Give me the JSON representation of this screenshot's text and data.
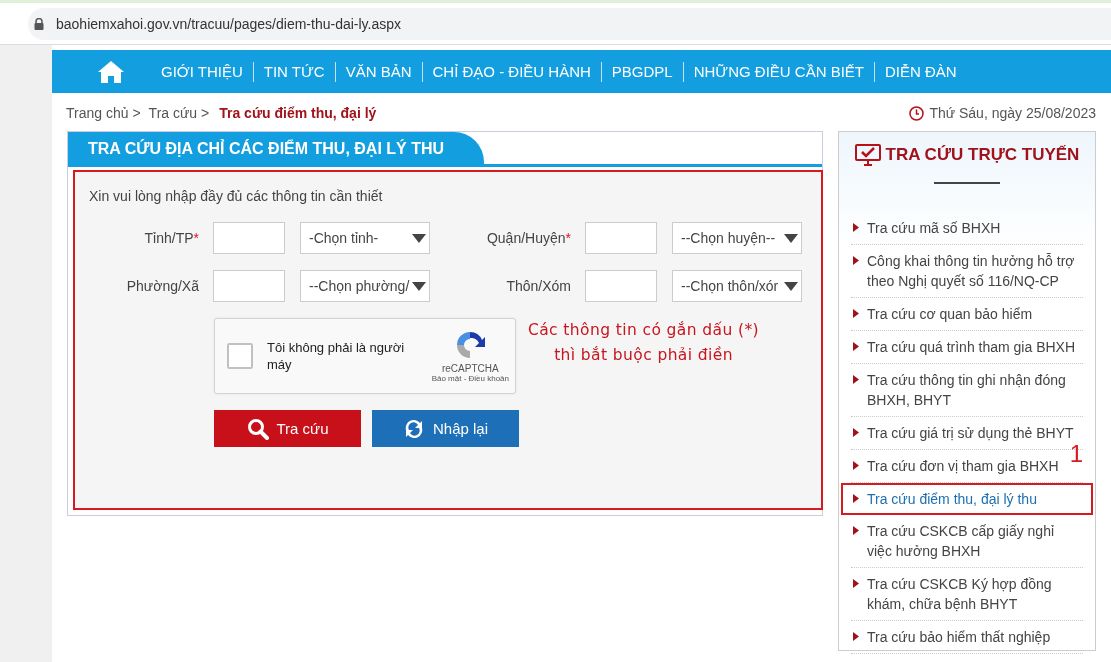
{
  "address_bar": {
    "url": "baohiemxahoi.gov.vn/tracuu/pages/diem-thu-dai-ly.aspx"
  },
  "nav": {
    "items": [
      "GIỚI THIỆU",
      "TIN TỨC",
      "VĂN BẢN",
      "CHỈ ĐẠO - ĐIỀU HÀNH",
      "PBGDPL",
      "NHỮNG ĐIỀU CẦN BIẾT",
      "DIỄN ĐÀN"
    ]
  },
  "breadcrumb": {
    "items": [
      "Trang chủ >",
      "Tra cứu >"
    ],
    "current": "Tra cứu điểm thu, đại lý",
    "date": "Thứ Sáu, ngày 25/08/2023"
  },
  "form": {
    "title": "TRA CỨU ĐỊA CHỈ CÁC ĐIỂM THU, ĐẠI LÝ THU",
    "instruction": "Xin vui lòng nhập đầy đủ các thông tin cần thiết",
    "fields": [
      {
        "label": "Tỉnh/TP",
        "required": true,
        "select": "-Chọn tỉnh-"
      },
      {
        "label": "Quận/Huyện",
        "required": true,
        "select": "--Chọn huyện--"
      },
      {
        "label": "Phường/Xã",
        "required": false,
        "select": "--Chọn phường/"
      },
      {
        "label": "Thôn/Xóm",
        "required": false,
        "select": "--Chọn thôn/xór"
      }
    ],
    "required_mark": "*",
    "captcha": {
      "label": "Tôi không phải là người máy",
      "checked": false,
      "brand": "reCAPTCHA",
      "links": "Bảo mật - Điều khoản"
    },
    "note": [
      "Các thông tin có gắn dấu (*)",
      "thì bắt buộc phải điền"
    ],
    "buttons": [
      {
        "kind": "search",
        "label": "Tra cứu"
      },
      {
        "kind": "reset",
        "label": "Nhập lại"
      }
    ]
  },
  "sidebar": {
    "title": "TRA CỨU TRỰC TUYẾN",
    "annotation": "1",
    "items": [
      {
        "label": "Tra cứu mã số BHXH",
        "selected": false
      },
      {
        "label": "Công khai thông tin hưởng hỗ trợ theo Nghị quyết số 116/NQ-CP",
        "selected": false
      },
      {
        "label": "Tra cứu cơ quan bảo hiểm",
        "selected": false
      },
      {
        "label": "Tra cứu quá trình tham gia BHXH",
        "selected": false
      },
      {
        "label": "Tra cứu thông tin ghi nhận đóng BHXH, BHYT",
        "selected": false
      },
      {
        "label": "Tra cứu giá trị sử dụng thẻ BHYT",
        "selected": false
      },
      {
        "label": "Tra cứu đơn vị tham gia BHXH",
        "selected": false
      },
      {
        "label": "Tra cứu điểm thu, đại lý thu",
        "selected": true
      },
      {
        "label": "Tra cứu CSKCB cấp giấy nghỉ việc hưởng BHXH",
        "selected": false
      },
      {
        "label": "Tra cứu CSKCB Ký hợp đồng khám, chữa bệnh BHYT",
        "selected": false
      },
      {
        "label": "Tra cứu bảo hiểm thất nghiệp",
        "selected": false
      }
    ]
  }
}
